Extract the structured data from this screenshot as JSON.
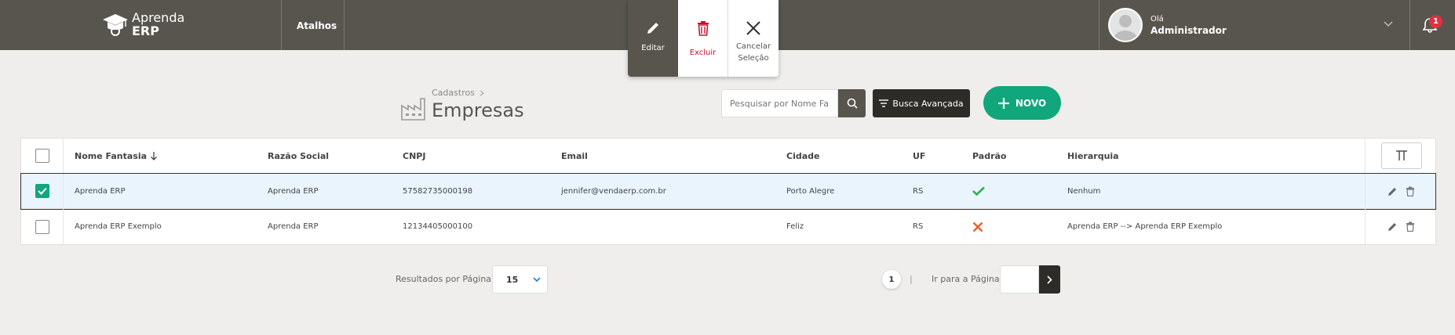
{
  "brand": {
    "line1": "Aprenda",
    "line2": "ERP"
  },
  "nav": {
    "shortcuts": "Atalhos"
  },
  "selection_actions": {
    "edit": "Editar",
    "delete": "Excluir",
    "cancel_line1": "Cancelar",
    "cancel_line2": "Seleção"
  },
  "user": {
    "greeting": "Olá",
    "name": "Administrador",
    "notifications": "1"
  },
  "page": {
    "breadcrumb": "Cadastros",
    "title": "Empresas"
  },
  "toolbar": {
    "search_placeholder": "Pesquisar por Nome Fan",
    "advanced_search": "Busca Avançada",
    "new": "NOVO"
  },
  "table": {
    "headers": {
      "nome_fantasia": "Nome Fantasia",
      "razao_social": "Razão Social",
      "cnpj": "CNPJ",
      "email": "Email",
      "cidade": "Cidade",
      "uf": "UF",
      "padrao": "Padrão",
      "hierarquia": "Hierarquia"
    },
    "rows": [
      {
        "selected": true,
        "nome_fantasia": "Aprenda ERP",
        "razao_social": "Aprenda ERP",
        "cnpj": "57582735000198",
        "email": "jennifer@vendaerp.com.br",
        "cidade": "Porto Alegre",
        "uf": "RS",
        "padrao": true,
        "hierarquia": "Nenhum"
      },
      {
        "selected": false,
        "nome_fantasia": "Aprenda ERP Exemplo",
        "razao_social": "Aprenda ERP",
        "cnpj": "12134405000100",
        "email": "",
        "cidade": "Feliz",
        "uf": "RS",
        "padrao": false,
        "hierarquia": "Aprenda ERP --> Aprenda ERP Exemplo"
      }
    ]
  },
  "pagination": {
    "per_page_label": "Resultados por Página",
    "per_page_value": "15",
    "current_page": "1",
    "separator": "|",
    "goto_label": "Ir para a Página"
  },
  "colors": {
    "topbar": "#57554e",
    "accent": "#11a67b",
    "danger": "#c8102e",
    "dark": "#2d2c28"
  }
}
